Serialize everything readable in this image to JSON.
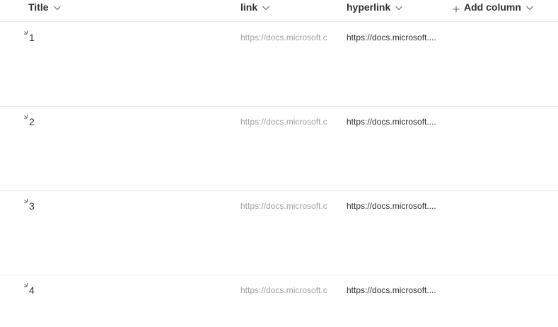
{
  "columns": {
    "title": "Title",
    "link": "link",
    "hyperlink": "hyperlink",
    "add_column": "Add column"
  },
  "rows": [
    {
      "title": "1",
      "link": "https://docs.microsoft.c",
      "hyperlink": "https://docs.microsoft...."
    },
    {
      "title": "2",
      "link": "https://docs.microsoft.c",
      "hyperlink": "https://docs.microsoft...."
    },
    {
      "title": "3",
      "link": "https://docs.microsoft.c",
      "hyperlink": "https://docs.microsoft...."
    },
    {
      "title": "4",
      "link": "https://docs.microsoft.c",
      "hyperlink": "https://docs.microsoft...."
    }
  ],
  "icons": {
    "column_sort": "chevron-down-icon",
    "add_column": "plus-icon",
    "new_item": "new-item-sparkle-icon"
  },
  "colors": {
    "header_text": "#323130",
    "link_text": "#a19f9d",
    "hyperlink_text": "#323130",
    "divider": "#edebe9"
  }
}
